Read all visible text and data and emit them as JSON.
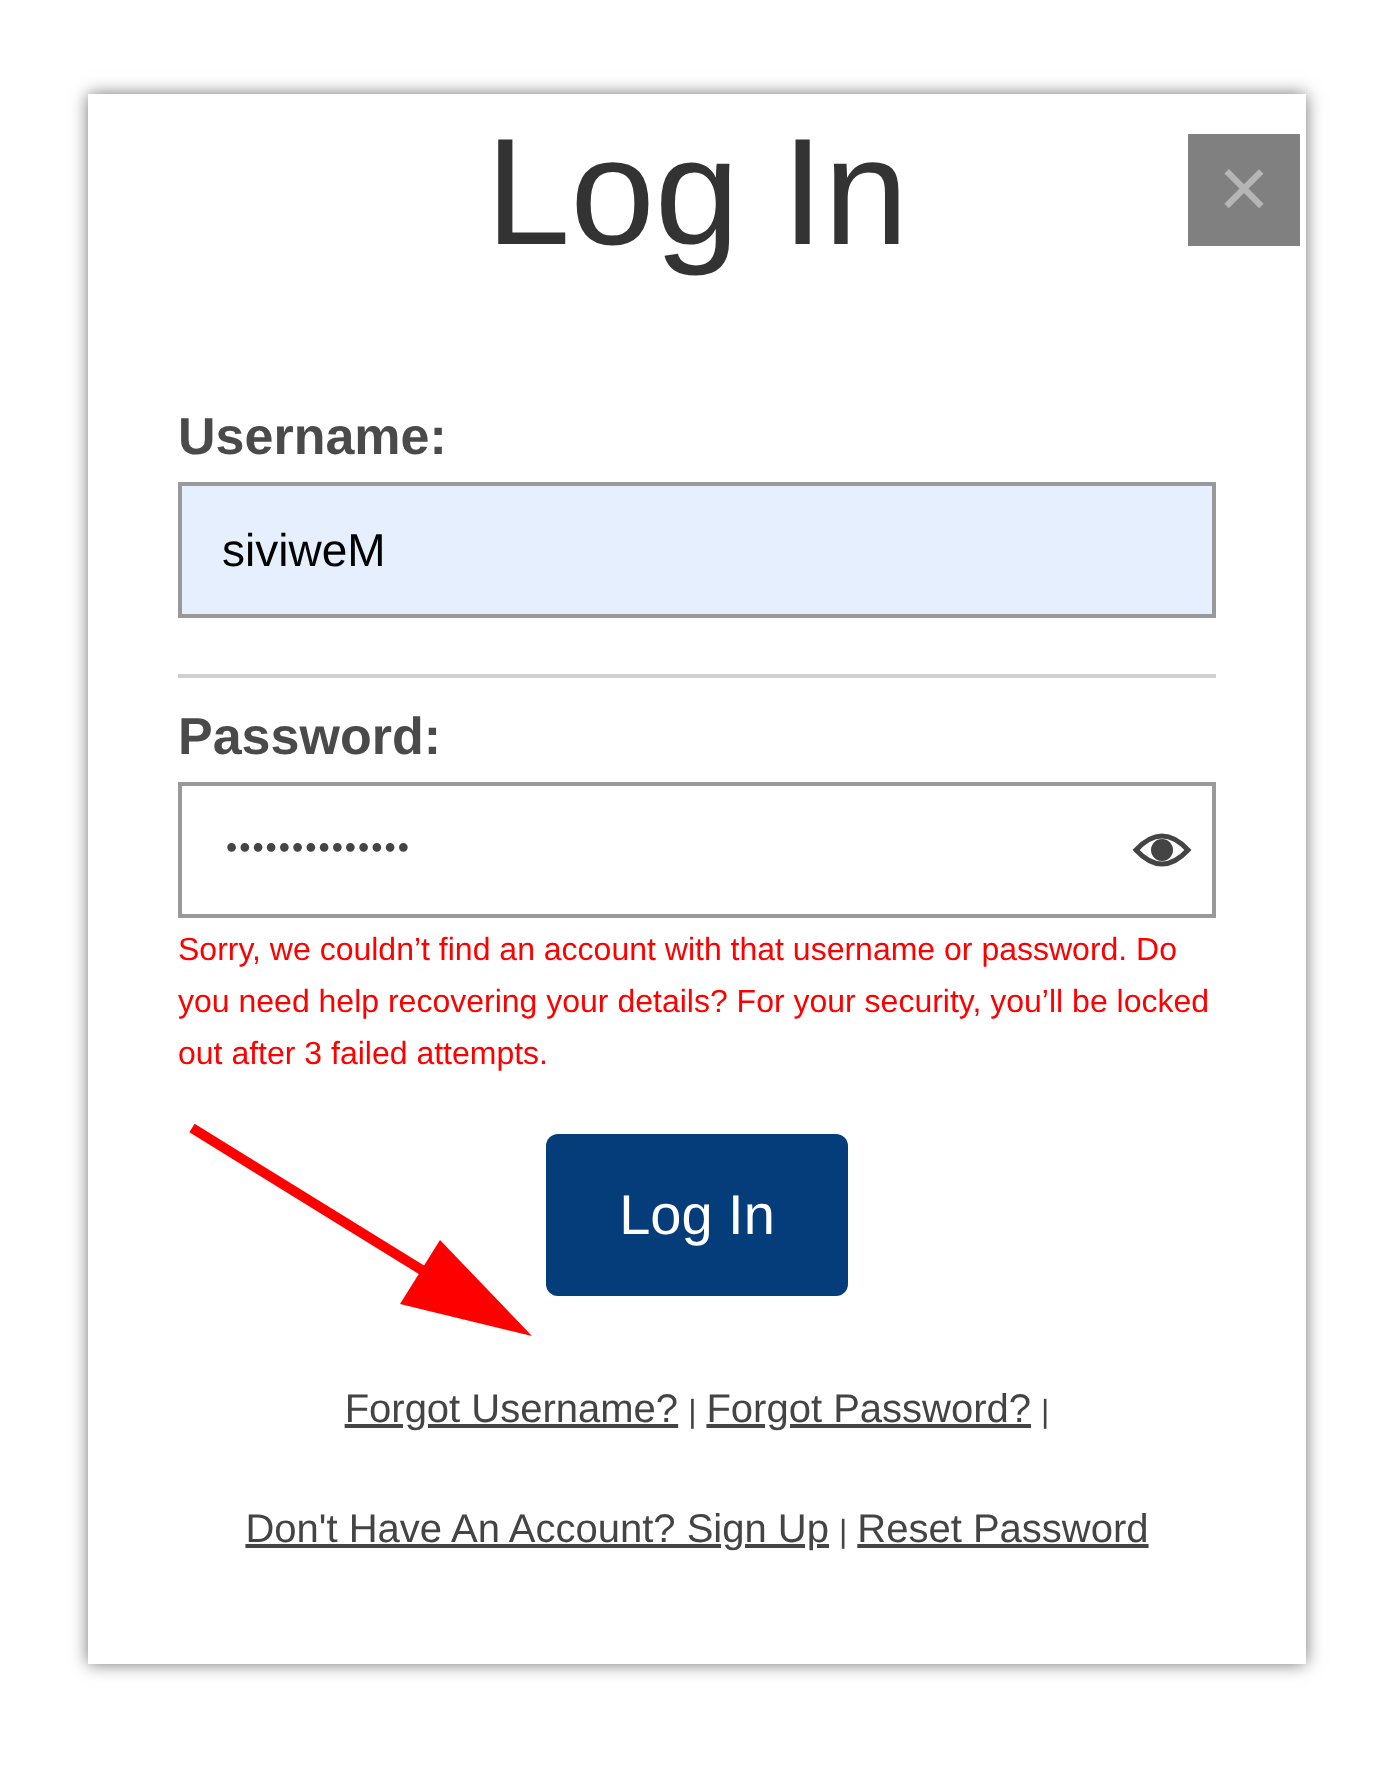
{
  "dialog": {
    "title": "Log In",
    "close_label": "×"
  },
  "username": {
    "label": "Username:",
    "value": "siviweM",
    "autofilled": true
  },
  "password": {
    "label": "Password:",
    "value": "••••••••••••••"
  },
  "error": "Sorry, we couldn’t find an account with that username or password. Do you need help recovering your details? For your security, you’ll be locked out after 3 failed attempts.",
  "submit": "Log In",
  "link_rows": [
    [
      {
        "kind": "link",
        "text": "Forgot Username?"
      },
      {
        "kind": "separator",
        "text": "|"
      },
      {
        "kind": "link",
        "text": "Forgot Password?"
      },
      {
        "kind": "separator",
        "text": "|"
      }
    ],
    [
      {
        "kind": "link",
        "text": "Don't Have An Account? Sign Up"
      },
      {
        "kind": "separator",
        "text": "|"
      },
      {
        "kind": "link",
        "text": "Reset Password"
      }
    ]
  ]
}
